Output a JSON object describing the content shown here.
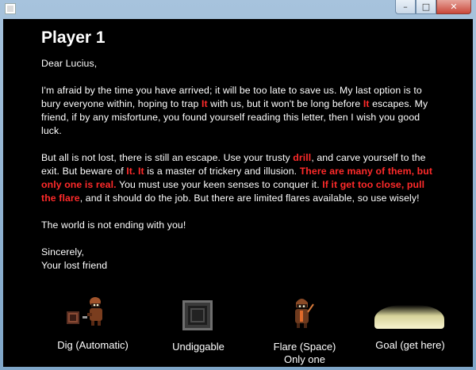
{
  "window": {
    "controls": {
      "minimize": "–",
      "maximize": "□",
      "close": "✕"
    }
  },
  "heading": "Player 1",
  "letter": {
    "greeting": "Dear Lucius,",
    "p1": [
      {
        "t": "I'm afraid by the time you have arrived; it will be too late to save us. My last option is to bury everyone within, hoping to trap "
      },
      {
        "t": "It",
        "hl": true
      },
      {
        "t": " with us, but it won't be long before "
      },
      {
        "t": "It",
        "hl": true
      },
      {
        "t": " escapes. My friend, if by any misfortune, you found yourself reading this letter, then I wish you good luck."
      }
    ],
    "p2": [
      {
        "t": "But all is not lost, there is still an escape. Use your trusty "
      },
      {
        "t": "drill",
        "hl": true
      },
      {
        "t": ", and carve yourself to the exit. But beware of "
      },
      {
        "t": "It.",
        "hl": true
      },
      {
        "t": " "
      },
      {
        "t": "It",
        "hl": true
      },
      {
        "t": " is a master of trickery and illusion. "
      },
      {
        "t": "There are many of them, but only one is real.",
        "hl": true
      },
      {
        "t": " You must use your keen senses to conquer it. "
      },
      {
        "t": "If it get too close, pull the flare",
        "hl": true
      },
      {
        "t": ", and it should do the job. But there are limited flares available, so use wisely!"
      }
    ],
    "p3": "The world is not ending with you!",
    "closing": "Sincerely,",
    "signature": "Your lost friend"
  },
  "legend": {
    "dig": "Dig (Automatic)",
    "undiggable": "Undiggable",
    "flare": "Flare (Space)",
    "flare_note": "Only one",
    "goal": "Goal (get here)"
  },
  "colors": {
    "background": "#000000",
    "text": "#ffffff",
    "highlight": "#ff2a2a",
    "goal_glow": "#f7f3cf"
  }
}
